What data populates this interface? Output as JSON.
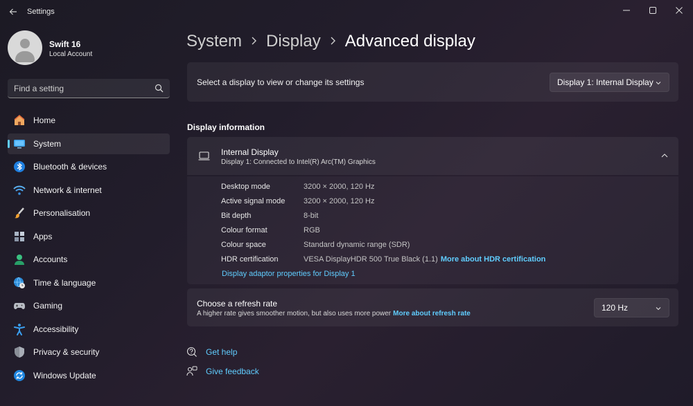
{
  "window": {
    "app_title": "Settings"
  },
  "account": {
    "name": "Swift 16",
    "type": "Local Account"
  },
  "search": {
    "placeholder": "Find a setting"
  },
  "sidebar": {
    "items": [
      {
        "label": "Home",
        "icon": "home-icon",
        "active": false
      },
      {
        "label": "System",
        "icon": "monitor-icon",
        "active": true
      },
      {
        "label": "Bluetooth & devices",
        "icon": "bluetooth-icon",
        "active": false
      },
      {
        "label": "Network & internet",
        "icon": "wifi-icon",
        "active": false
      },
      {
        "label": "Personalisation",
        "icon": "brush-icon",
        "active": false
      },
      {
        "label": "Apps",
        "icon": "apps-icon",
        "active": false
      },
      {
        "label": "Accounts",
        "icon": "person-icon",
        "active": false
      },
      {
        "label": "Time & language",
        "icon": "globe-clock-icon",
        "active": false
      },
      {
        "label": "Gaming",
        "icon": "gamepad-icon",
        "active": false
      },
      {
        "label": "Accessibility",
        "icon": "accessibility-icon",
        "active": false
      },
      {
        "label": "Privacy & security",
        "icon": "shield-icon",
        "active": false
      },
      {
        "label": "Windows Update",
        "icon": "update-icon",
        "active": false
      }
    ]
  },
  "breadcrumb": {
    "items": [
      "System",
      "Display"
    ],
    "current": "Advanced display"
  },
  "display_select": {
    "text": "Select a display to view or change its settings",
    "value": "Display 1: Internal Display"
  },
  "display_info": {
    "section_title": "Display information",
    "title": "Internal Display",
    "subtitle": "Display 1: Connected to Intel(R) Arc(TM) Graphics",
    "properties": [
      {
        "label": "Desktop mode",
        "value": "3200 × 2000, 120 Hz"
      },
      {
        "label": "Active signal mode",
        "value": "3200 × 2000, 120 Hz"
      },
      {
        "label": "Bit depth",
        "value": "8-bit"
      },
      {
        "label": "Colour format",
        "value": "RGB"
      },
      {
        "label": "Colour space",
        "value": "Standard dynamic range (SDR)"
      },
      {
        "label": "HDR certification",
        "value": "VESA DisplayHDR 500 True Black (1.1)"
      }
    ],
    "hdr_link": "More about HDR certification",
    "adaptor_link": "Display adaptor properties for Display 1"
  },
  "refresh_rate": {
    "title": "Choose a refresh rate",
    "subtitle": "A higher rate gives smoother motion, but also uses more power",
    "link": "More about refresh rate",
    "value": "120 Hz"
  },
  "help": {
    "get_help": "Get help",
    "give_feedback": "Give feedback"
  },
  "colors": {
    "accent": "#60cdff",
    "background": "#201c28"
  }
}
